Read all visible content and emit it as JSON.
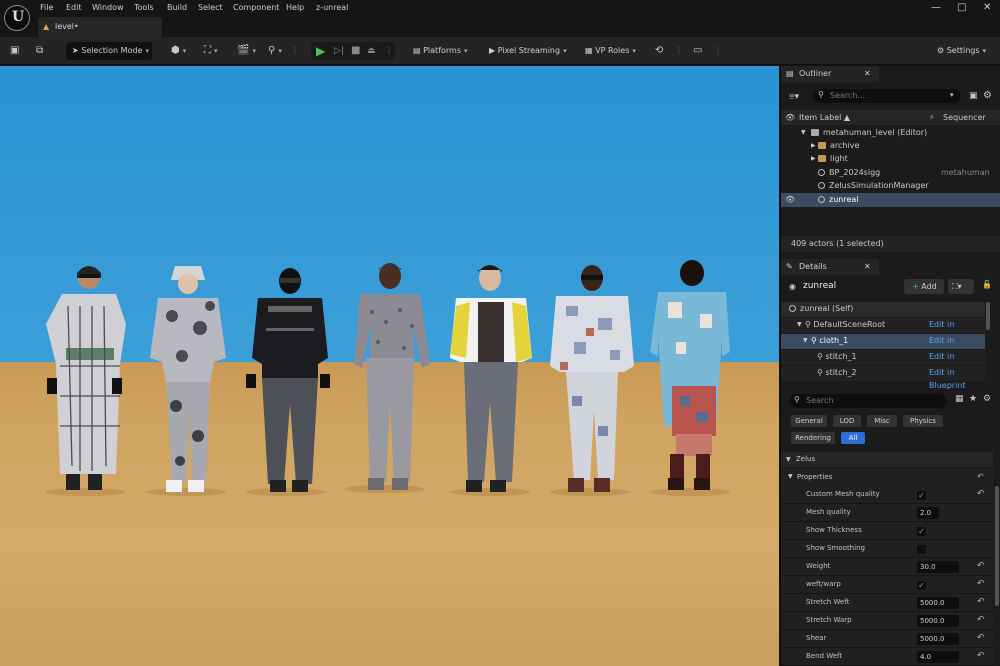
{
  "menu": [
    "File",
    "Edit",
    "Window",
    "Tools",
    "Build",
    "Select",
    "Component",
    "Help",
    "z-unreal"
  ],
  "document_tab": {
    "label": "level•"
  },
  "window_controls": {
    "minimize": "—",
    "maximize": "□",
    "close": "✕"
  },
  "toolbar": {
    "selection_mode": "Selection Mode",
    "platforms": "Platforms",
    "pixel_streaming": "Pixel Streaming",
    "vp_roles": "VP Roles",
    "settings": "Settings"
  },
  "outliner": {
    "tab_label": "Outliner",
    "search_placeholder": "Search...",
    "col_item_label": "Item Label ▲",
    "col_sequencer": "Sequencer",
    "items": [
      {
        "label": "metahuman_level (Editor)",
        "type": ""
      },
      {
        "label": "archive",
        "type": ""
      },
      {
        "label": "light",
        "type": ""
      },
      {
        "label": "BP_2024sigg",
        "type": "metahuman"
      },
      {
        "label": "ZelusSimulationManager",
        "type": ""
      },
      {
        "label": "zunreal",
        "type": ""
      }
    ],
    "status": "409 actors (1 selected)"
  },
  "details": {
    "tab_label": "Details",
    "actor_name": "zunreal",
    "add_label": "Add",
    "components": [
      {
        "label": "zunreal (Self)",
        "action": ""
      },
      {
        "label": "DefaultSceneRoot",
        "action": "Edit in Blueprint"
      },
      {
        "label": "cloth_1",
        "action": "Edit in Blueprint"
      },
      {
        "label": "stitch_1",
        "action": "Edit in Blueprint"
      },
      {
        "label": "stitch_2",
        "action": "Edit in Blueprint"
      }
    ],
    "search_placeholder": "Search",
    "filters": [
      "General",
      "LOD",
      "Misc",
      "Physics",
      "Rendering",
      "All"
    ],
    "section": "Zelus",
    "subsection": "Properties",
    "properties": [
      {
        "name": "Custom Mesh quality",
        "kind": "check",
        "value": "✓"
      },
      {
        "name": "Mesh quality",
        "kind": "num",
        "value": "2.0"
      },
      {
        "name": "Show Thickness",
        "kind": "check",
        "value": "✓"
      },
      {
        "name": "Show Smoothing",
        "kind": "check",
        "value": ""
      },
      {
        "name": "Weight",
        "kind": "num",
        "value": "30.0"
      },
      {
        "name": "weft/warp",
        "kind": "check",
        "value": "✓"
      },
      {
        "name": "Stretch Weft",
        "kind": "num",
        "value": "5000.0"
      },
      {
        "name": "Stretch Warp",
        "kind": "num",
        "value": "5000.0"
      },
      {
        "name": "Shear",
        "kind": "num",
        "value": "5000.0"
      },
      {
        "name": "Bend Weft",
        "kind": "num",
        "value": "4.0"
      }
    ]
  },
  "colors": {
    "accent_blue": "#4fa3ff",
    "selection": "#3a4b62",
    "play_green": "#4cc35a",
    "sky": "#2a93d3",
    "sand": "#d0a461"
  }
}
